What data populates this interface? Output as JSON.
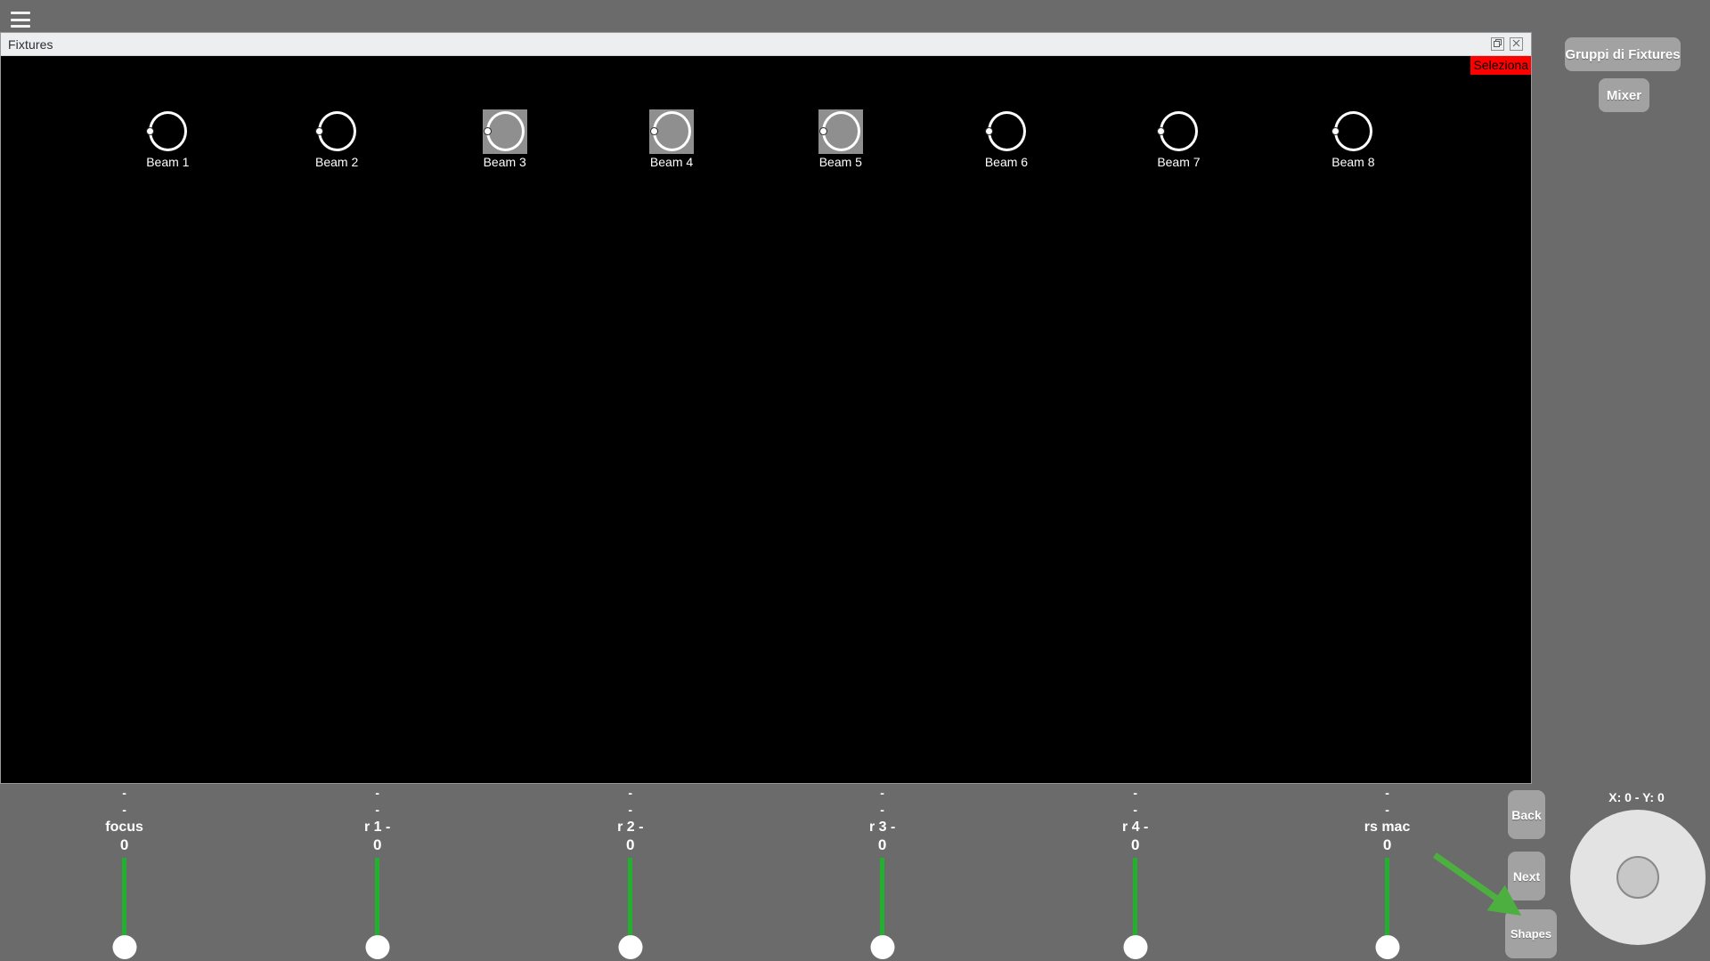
{
  "app": {
    "menu_icon": "hamburger-menu-icon",
    "background_color": "#6b6b6b"
  },
  "fixtures_window": {
    "title": "Fixtures",
    "restore_label": "❐",
    "close_label": "☒",
    "badge": "Seleziona",
    "badge_color": "#ff0000",
    "fixtures": [
      {
        "label": "Beam 1",
        "selected": false
      },
      {
        "label": "Beam 2",
        "selected": false
      },
      {
        "label": "Beam 3",
        "selected": true
      },
      {
        "label": "Beam 4",
        "selected": true
      },
      {
        "label": "Beam 5",
        "selected": true
      },
      {
        "label": "Beam 6",
        "selected": false
      },
      {
        "label": "Beam 7",
        "selected": false
      },
      {
        "label": "Beam 8",
        "selected": false
      }
    ]
  },
  "side_panel": {
    "gruppi_label": "Gruppi di Fixtures",
    "mixer_label": "Mixer"
  },
  "bottom_panel": {
    "sliders": [
      {
        "dash1": "-",
        "dash2": "-",
        "name": "focus",
        "value": "0"
      },
      {
        "dash1": "-",
        "dash2": "-",
        "name": "r 1 -",
        "value": "0"
      },
      {
        "dash1": "-",
        "dash2": "-",
        "name": "r 2 -",
        "value": "0"
      },
      {
        "dash1": "-",
        "dash2": "-",
        "name": "r 3 -",
        "value": "0"
      },
      {
        "dash1": "-",
        "dash2": "-",
        "name": "r 4 -",
        "value": "0"
      },
      {
        "dash1": "-",
        "dash2": "-",
        "name": "rs mac",
        "value": "0"
      }
    ],
    "back_label": "Back",
    "next_label": "Next",
    "shapes_label": "Shapes",
    "arrow_color": "#4caf3f",
    "joystick": {
      "coords": "X: 0 - Y: 0"
    }
  }
}
